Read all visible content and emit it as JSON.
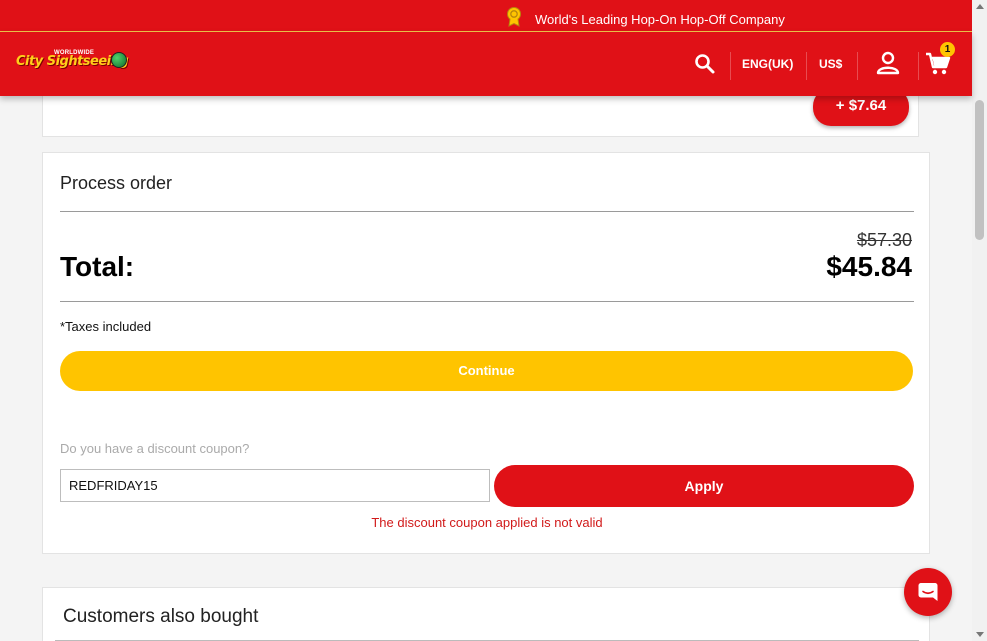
{
  "promo": {
    "text": "World's Leading Hop-On Hop-Off Company"
  },
  "header": {
    "logo_top": "WORLDWIDE",
    "logo_text": "City Sightseeing",
    "language": "ENG(UK)",
    "currency": "US$",
    "cart_count": "1"
  },
  "previous_card": {
    "extra_price": "+ $7.64"
  },
  "order": {
    "title": "Process order",
    "old_price": "$57.30",
    "total_label": "Total:",
    "total_value": "$45.84",
    "taxes": "*Taxes included",
    "continue_label": "Continue",
    "coupon_question": "Do you have a discount coupon?",
    "coupon_value": "REDFRIDAY15",
    "apply_label": "Apply",
    "error": "The discount coupon applied is not valid"
  },
  "also_bought": {
    "title": "Customers also bought"
  },
  "colors": {
    "brand_red": "#e01117",
    "accent_yellow": "#ffc400",
    "error_red": "#d11a1a"
  },
  "icons": [
    "award-icon",
    "search-icon",
    "user-icon",
    "cart-icon",
    "chat-icon"
  ]
}
